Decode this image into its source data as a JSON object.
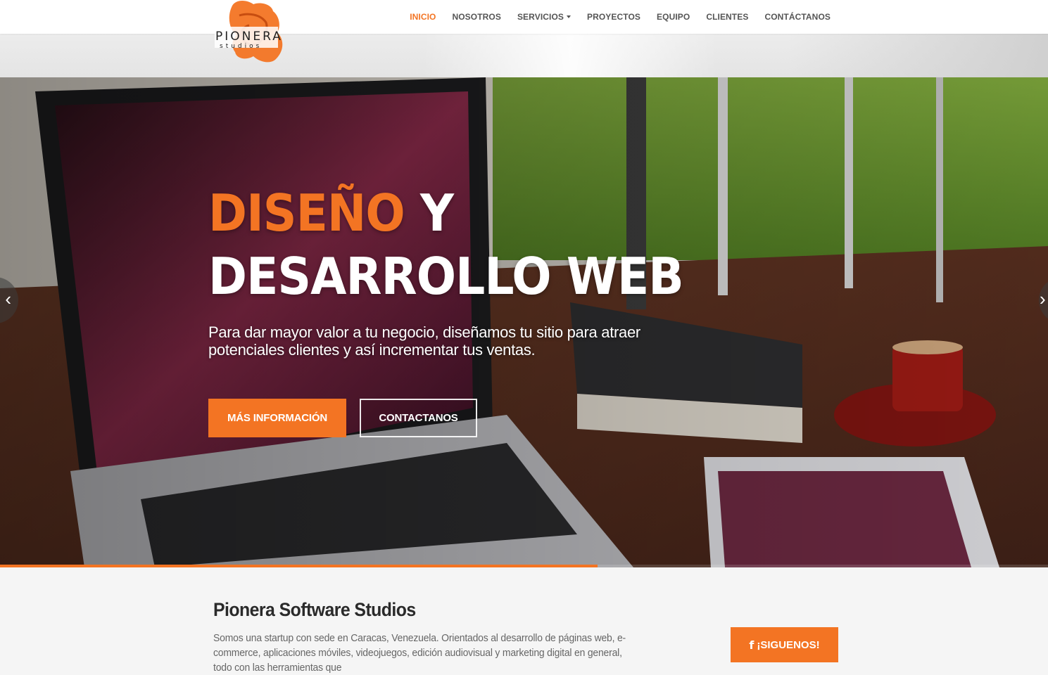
{
  "brand": {
    "logo_text": "PIONERA",
    "logo_subtext": "studios",
    "accent_color": "#f37423"
  },
  "nav": {
    "items": [
      {
        "label": "INICIO",
        "active": true
      },
      {
        "label": "NOSOTROS"
      },
      {
        "label": "SERVICIOS",
        "dropdown": true
      },
      {
        "label": "PROYECTOS"
      },
      {
        "label": "EQUIPO"
      },
      {
        "label": "CLIENTES"
      },
      {
        "label": "CONTÁCTANOS"
      }
    ]
  },
  "hero": {
    "title_accent": "DISEÑO",
    "title_rest": " Y",
    "title_line2": "DESARROLLO WEB",
    "subtitle": "Para dar mayor valor a tu negocio, diseñamos tu sitio para atraer potenciales clientes y así incrementar tus ventas.",
    "primary_button": "MÁS INFORMACIÓN",
    "secondary_button": "CONTACTANOS",
    "prev_icon": "chevron-left-icon",
    "next_icon": "chevron-right-icon",
    "slide_progress": 0.57
  },
  "about": {
    "title": "Pionera Software Studios",
    "text": "Somos una startup con sede en Caracas, Venezuela. Orientados al desarrollo de páginas web, e-commerce, aplicaciones móviles, videojuegos, edición audiovisual y marketing digital en general, todo con las herramientas que",
    "follow_icon": "facebook-icon",
    "follow_button": "¡SIGUENOS!"
  }
}
